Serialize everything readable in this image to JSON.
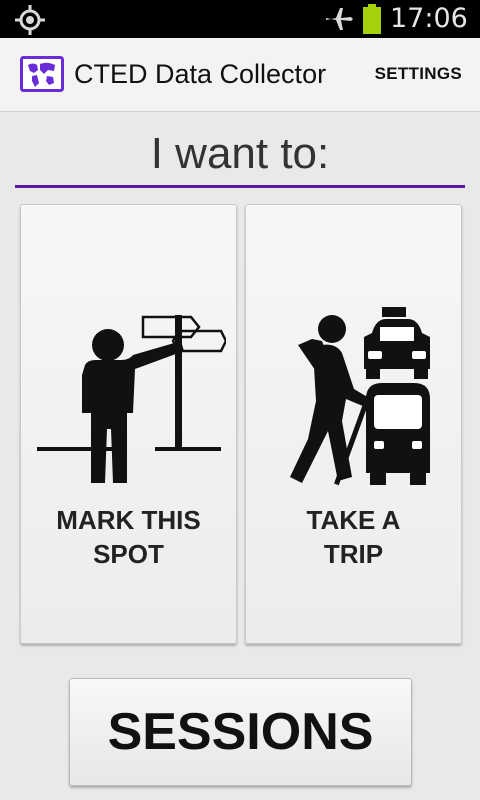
{
  "status_bar": {
    "time": "17:06",
    "icons": [
      "location-icon",
      "airplane-mode-icon",
      "battery-icon"
    ],
    "battery_color": "#a4d20c"
  },
  "action_bar": {
    "title": "CTED Data Collector",
    "settings_label": "SETTINGS",
    "icon": "map-icon",
    "accent_color": "#6a2bd9"
  },
  "main": {
    "heading": "I want to:",
    "divider_color": "#5a1a9e",
    "tiles": [
      {
        "label_line1": "MARK THIS",
        "label_line2": "SPOT",
        "icon": "signpost-person-icon"
      },
      {
        "label_line1": "TAKE A",
        "label_line2": "TRIP",
        "icon": "hiker-taxi-bus-icon"
      }
    ],
    "sessions_label": "SESSIONS"
  }
}
